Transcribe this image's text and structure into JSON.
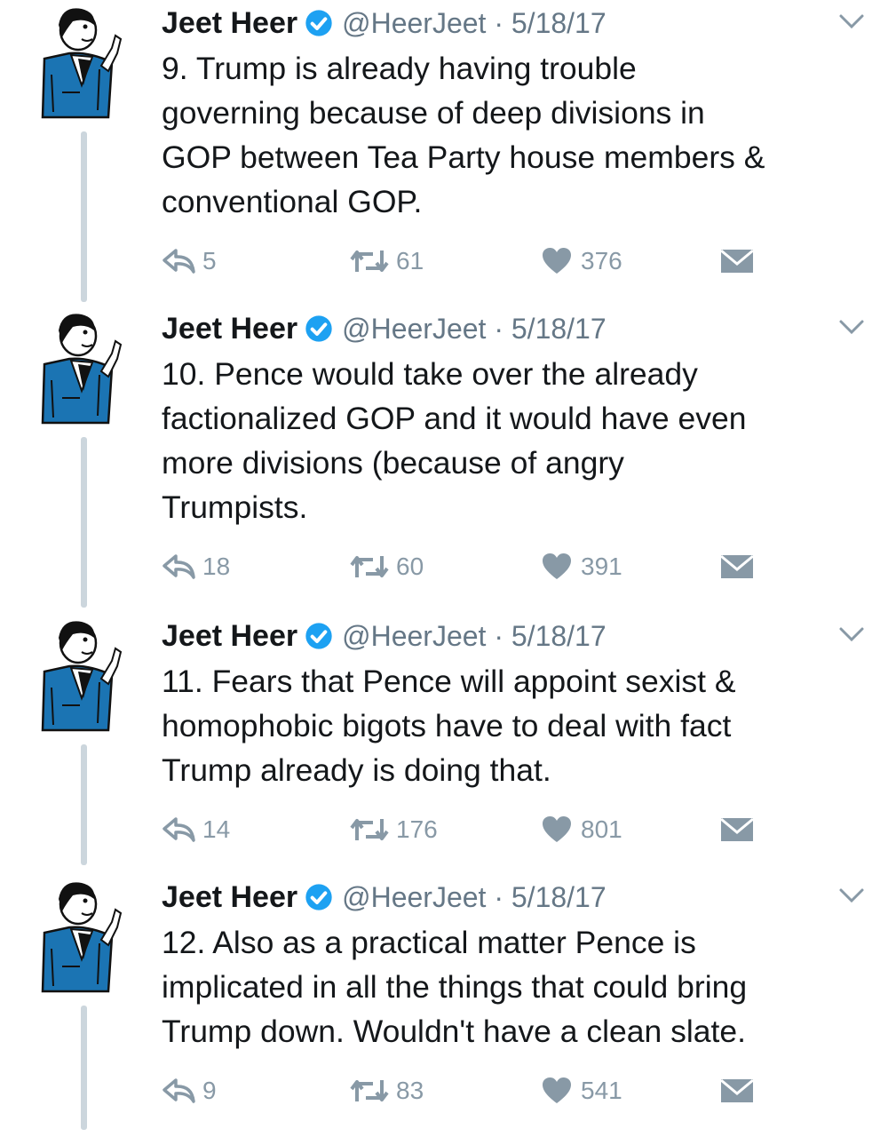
{
  "colors": {
    "verified": "#1da1f2",
    "muted": "#8899a6",
    "handle": "#657786",
    "thread_line": "#ccd6dd",
    "jacket": "#1b74b3"
  },
  "icons": {
    "reply": "reply-icon",
    "retweet": "retweet-icon",
    "like": "heart-icon",
    "dm": "envelope-icon",
    "verified": "verified-badge-icon",
    "menu": "chevron-down-icon"
  },
  "tweets": [
    {
      "name": "Jeet Heer",
      "handle_date": "@HeerJeet · 5/18/17",
      "text": "9. Trump is already having trouble\ngoverning because of deep divisions in\nGOP between Tea Party house members &\nconventional GOP.",
      "replies": "5",
      "retweets": "61",
      "likes": "376"
    },
    {
      "name": "Jeet Heer",
      "handle_date": "@HeerJeet · 5/18/17",
      "text": "10. Pence would take over the already\nfactionalized GOP and it would have even\nmore divisions (because of angry\nTrumpists.",
      "replies": "18",
      "retweets": "60",
      "likes": "391"
    },
    {
      "name": "Jeet Heer",
      "handle_date": "@HeerJeet · 5/18/17",
      "text": "11. Fears that Pence will appoint sexist &\nhomophobic bigots have to deal with fact\nTrump already is doing that.",
      "replies": "14",
      "retweets": "176",
      "likes": "801"
    },
    {
      "name": "Jeet Heer",
      "handle_date": "@HeerJeet · 5/18/17",
      "text": "12. Also as a practical matter Pence is\nimplicated in all the things that could bring\nTrump down. Wouldn't have a clean slate.",
      "replies": "9",
      "retweets": "83",
      "likes": "541"
    }
  ]
}
